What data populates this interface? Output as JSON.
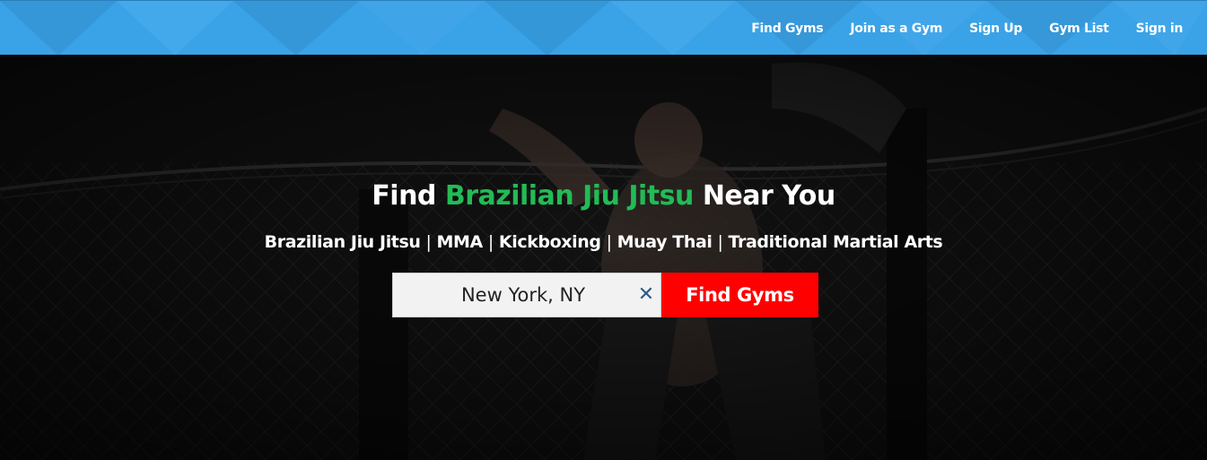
{
  "nav": {
    "items": [
      {
        "label": "Find Gyms"
      },
      {
        "label": "Join as a Gym"
      },
      {
        "label": "Sign Up"
      },
      {
        "label": "Gym List"
      },
      {
        "label": "Sign in"
      }
    ]
  },
  "hero": {
    "headline_prefix": "Find",
    "headline_accent": "Brazilian Jiu Jitsu",
    "headline_suffix": "Near You",
    "disciplines": [
      "Brazilian Jiu Jitsu",
      "MMA",
      "Kickboxing",
      "Muay Thai",
      "Traditional Martial Arts"
    ],
    "separator": "|"
  },
  "search": {
    "location_value": "New York, NY",
    "clear_icon": "close-icon",
    "submit_label": "Find Gyms"
  },
  "colors": {
    "topbar": "#3aa2e6",
    "accent_green": "#22bb55",
    "button_red": "#ff0000",
    "clear_icon": "#2d5a8a"
  }
}
